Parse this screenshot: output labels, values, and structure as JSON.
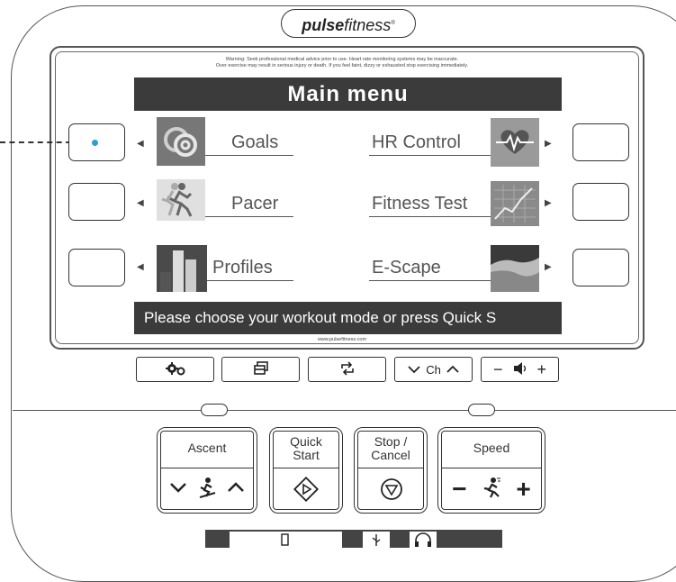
{
  "brand": {
    "name_bold": "pulse",
    "name_light": "fitness",
    "mark": "®"
  },
  "warning": {
    "line1": "Warning: Seek professional medical advice prior to use. Heart rate monitoring systems may be inaccurate.",
    "line2": "Over exercise may result in serious injury or death.  If you feel faint, dizzy or exhausted stop exercising immediately."
  },
  "screen": {
    "title": "Main menu",
    "status": "Please choose your workout mode or press Quick S",
    "left_items": [
      {
        "label": "Goals",
        "icon": "goals-icon"
      },
      {
        "label": "Pacer",
        "icon": "runner-icon"
      },
      {
        "label": "Profiles",
        "icon": "bar-profile-icon"
      }
    ],
    "right_items": [
      {
        "label": "HR Control",
        "icon": "heart-rate-icon"
      },
      {
        "label": "Fitness Test",
        "icon": "chart-icon"
      },
      {
        "label": "E-Scape",
        "icon": "landscape-icon"
      }
    ]
  },
  "url": "www.pulsefitness.com",
  "function_keys": {
    "channel_label": "Ch",
    "settings_icon": "gears-icon",
    "window_icon": "window-icon",
    "repeat_icon": "repeat-icon",
    "volume_icon": "speaker-icon"
  },
  "controls": {
    "ascent": {
      "label": "Ascent"
    },
    "quick_start": {
      "label_line1": "Quick",
      "label_line2": "Start"
    },
    "stop_cancel": {
      "label_line1": "Stop /",
      "label_line2": "Cancel"
    },
    "speed": {
      "label": "Speed"
    }
  },
  "colors": {
    "screen_bar": "#3b3b3b",
    "indicator_dot": "#2a9fd6"
  }
}
